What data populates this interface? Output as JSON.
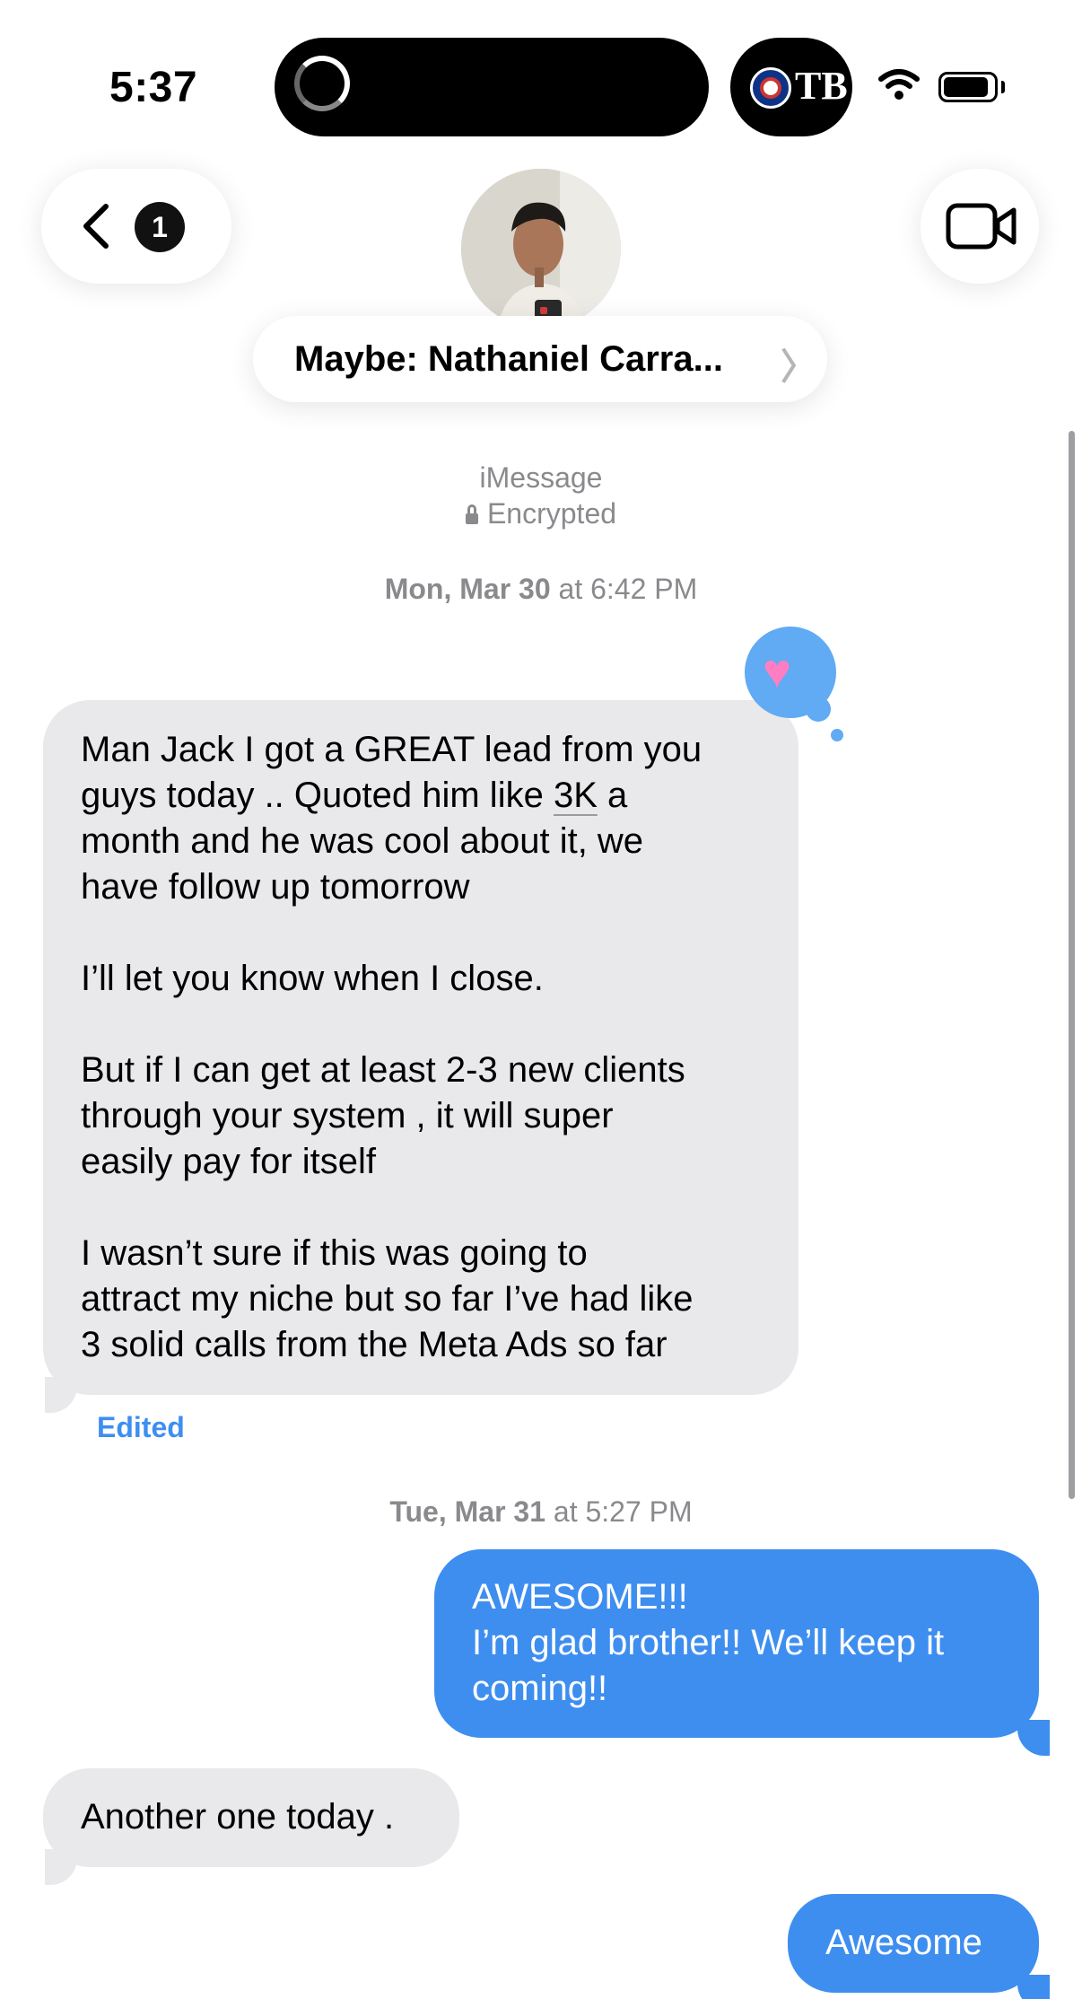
{
  "status_bar": {
    "time": "5:37",
    "live_activity_team": "TB",
    "battery_level_fraction": 0.9
  },
  "header": {
    "back_badge_count": "1",
    "contact_name": "Maybe: Nathaniel Carra...",
    "name_chevron": "〉",
    "icons": [
      "chevron-left-icon",
      "video-camera-icon"
    ]
  },
  "thread": {
    "service_label": "iMessage",
    "encryption_label": "Encrypted",
    "timestamps": [
      {
        "day": "Mon, Mar 30",
        "time": "at 6:42 PM"
      },
      {
        "day": "Tue, Mar 31",
        "time": "at 5:27 PM"
      }
    ],
    "messages": [
      {
        "direction": "incoming",
        "lines": [
          "Man Jack I got a GREAT lead from you",
          "guys today .. Quoted him like",
          "3K",
          "a",
          "month and he was cool about it, we",
          "have follow up tomorrow",
          "I’ll let you know when I close.",
          "But if I can get at least 2-3 new clients",
          "through your system , it will super",
          "easily pay for itself",
          "I wasn’t sure if this was going to",
          "attract my niche but so far I’ve had like",
          "3 solid calls from the Meta Ads so far"
        ],
        "status": "Edited",
        "reaction": "heart"
      },
      {
        "direction": "outgoing",
        "lines": [
          "AWESOME!!!",
          "I’m glad brother!! We’ll keep it",
          "coming!!"
        ]
      },
      {
        "direction": "incoming",
        "lines": [
          "Another one today ."
        ]
      },
      {
        "direction": "outgoing",
        "lines": [
          "Awesome"
        ]
      }
    ]
  },
  "colors": {
    "outgoing_bubble": "#3e8ef0",
    "incoming_bubble": "#e9e9eb",
    "meta_text": "#8a8a8e",
    "tapback": "#60abf3"
  }
}
